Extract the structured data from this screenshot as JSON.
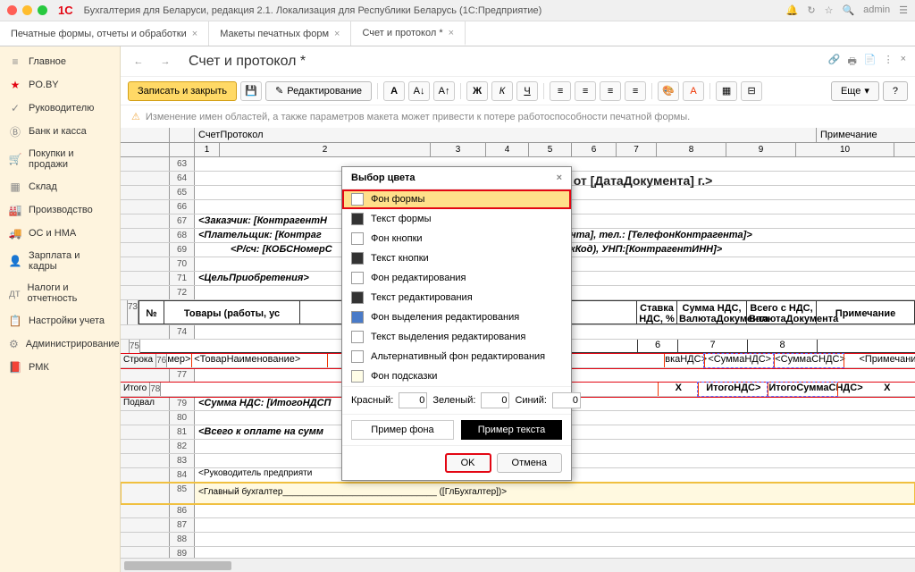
{
  "titlebar": {
    "app": "1C",
    "title": "Бухгалтерия для Беларуси, редакция 2.1. Локализация для Республики Беларусь   (1С:Предприятие)",
    "user": "admin"
  },
  "tabs": [
    {
      "label": "Печатные формы, отчеты и обработки",
      "closable": true
    },
    {
      "label": "Макеты печатных форм",
      "closable": true
    },
    {
      "label": "Счет и протокол *",
      "closable": true,
      "active": true
    }
  ],
  "sidebar": [
    {
      "icon": "≡",
      "label": "Главное"
    },
    {
      "icon": "★",
      "label": "PO.BY",
      "color": "#e30613"
    },
    {
      "icon": "✓",
      "label": "Руководителю"
    },
    {
      "icon": "Ⓑ",
      "label": "Банк и касса"
    },
    {
      "icon": "🛒",
      "label": "Покупки и продажи"
    },
    {
      "icon": "▦",
      "label": "Склад"
    },
    {
      "icon": "🏭",
      "label": "Производство"
    },
    {
      "icon": "🚚",
      "label": "ОС и НМА"
    },
    {
      "icon": "👤",
      "label": "Зарплата и кадры"
    },
    {
      "icon": "дт",
      "label": "Налоги и отчетность"
    },
    {
      "icon": "📋",
      "label": "Настройки учета"
    },
    {
      "icon": "⚙",
      "label": "Администрирование"
    },
    {
      "icon": "📕",
      "label": "РМК"
    }
  ],
  "page": {
    "title": "Счет и протокол *"
  },
  "toolbar": {
    "save": "Записать и закрыть",
    "edit": "Редактирование",
    "more": "Еще",
    "help": "?"
  },
  "warning": "Изменение имен областей, а также параметров макета может привести к потере работоспособности печатной формы.",
  "sheet": {
    "sectionLabel": "СчетПротокол",
    "noteLabel": "Примечание",
    "cols": [
      "1",
      "2",
      "3",
      "4",
      "5",
      "6",
      "7",
      "8",
      "9",
      "10"
    ],
    "rowStart": 63,
    "docTitle": "<Счет № [НомерДокумента] от [ДатаДокумента] г.>",
    "customer": "<Заказчик: [КонтрагентН",
    "payer": "<Плательщик: [Контраг",
    "account": "<Р/сч: [КОБСНомерС",
    "payerTail": "нта], тел.: [ТелефонКонтрагента]>",
    "accountTail": "кКод), УНП:[КонтрагентИНН]>",
    "purpose": "<ЦельПриобретения>",
    "th": {
      "num": "№",
      "goods": "Товары (работы, ус",
      "rate": "Ставка НДС, %",
      "ndsSum": "Сумма НДС, ВалютаДокумента",
      "total": "Всего с НДС, ВалютаДокумента",
      "note": "Примечание"
    },
    "hdrNums": {
      "c6": "6",
      "c7": "7",
      "c8": "8"
    },
    "rowLabels": {
      "stroka": "Строка",
      "itogo": "Итого",
      "podval": "Подвал"
    },
    "dataRow": {
      "name": "<ТоварНаименование>",
      "pref": "мер>",
      "rate": "вкаНДС>",
      "nds": "<СуммаНДС>",
      "total": "<СуммаСНДС>",
      "note": "<Примечание>"
    },
    "totalRow": {
      "x1": "X",
      "nds": "ИтогоНДС>",
      "total": "ИтогоСуммаСНДС>",
      "x2": "X"
    },
    "ndsSum": "<Сумма НДС: [ИтогоНДСП",
    "totalPay": "<Всего к оплате  на сумм",
    "director": "<Руководитель предприяти",
    "accountant": "<Главный бухгалтер_______________________________ ([ГлБухгалтер])>"
  },
  "modal": {
    "title": "Выбор цвета",
    "items": [
      {
        "label": "Фон формы",
        "color": "#ffffff",
        "selected": true
      },
      {
        "label": "Текст формы",
        "color": "#333333"
      },
      {
        "label": "Фон кнопки",
        "color": "#ffffff"
      },
      {
        "label": "Текст кнопки",
        "color": "#333333"
      },
      {
        "label": "Фон редактирования",
        "color": "#ffffff"
      },
      {
        "label": "Текст редактирования",
        "color": "#333333"
      },
      {
        "label": "Фон выделения редактирования",
        "color": "#4a7bc8"
      },
      {
        "label": "Текст выделения редактирования",
        "color": "#ffffff"
      },
      {
        "label": "Альтернативный фон редактирования",
        "color": "#ffffff"
      },
      {
        "label": "Фон подсказки",
        "color": "#fffde7"
      }
    ],
    "rgb": {
      "r": "Красный:",
      "g": "Зеленый:",
      "b": "Синий:",
      "rv": "0",
      "gv": "0",
      "bv": "0"
    },
    "previewBg": "Пример фона",
    "previewTxt": "Пример текста",
    "ok": "OK",
    "cancel": "Отмена"
  }
}
